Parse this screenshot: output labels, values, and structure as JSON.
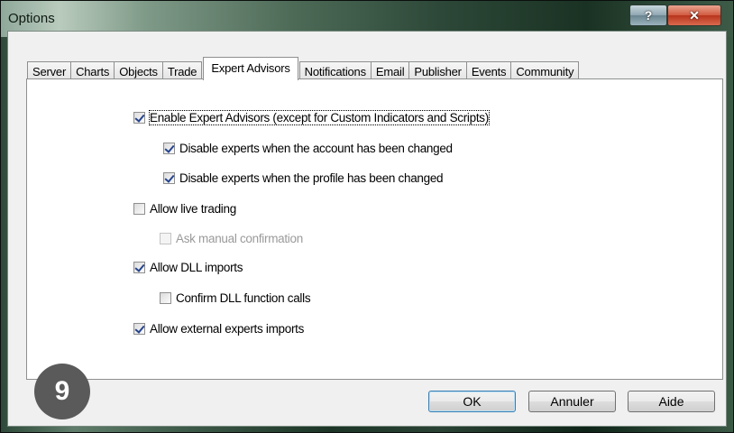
{
  "window": {
    "title": "Options"
  },
  "tabs": [
    "Server",
    "Charts",
    "Objects",
    "Trade",
    "Expert Advisors",
    "Notifications",
    "Email",
    "Publisher",
    "Events",
    "Community"
  ],
  "active_tab": "Expert Advisors",
  "options": {
    "enable_experts": {
      "label": "Enable Expert Advisors (except for Custom Indicators and Scripts)",
      "checked": true
    },
    "disable_on_account_change": {
      "label": "Disable experts when the account has been changed",
      "checked": true
    },
    "disable_on_profile_change": {
      "label": "Disable experts when the profile has been changed",
      "checked": true
    },
    "allow_live_trading": {
      "label": "Allow live trading",
      "checked": false
    },
    "ask_manual_confirmation": {
      "label": "Ask manual confirmation",
      "checked": false,
      "disabled": true
    },
    "allow_dll_imports": {
      "label": "Allow DLL imports",
      "checked": true
    },
    "confirm_dll_calls": {
      "label": "Confirm DLL function calls",
      "checked": false
    },
    "allow_external_imports": {
      "label": "Allow external experts imports",
      "checked": true
    }
  },
  "buttons": {
    "ok": "OK",
    "cancel": "Annuler",
    "help": "Aide"
  },
  "badge": {
    "number": "9"
  },
  "icons": {
    "help": "question-mark-icon",
    "close": "close-x-icon"
  },
  "colors": {
    "close_button": "#c8452c",
    "checkmark": "#24448f",
    "badge": "#5a5a5a"
  }
}
